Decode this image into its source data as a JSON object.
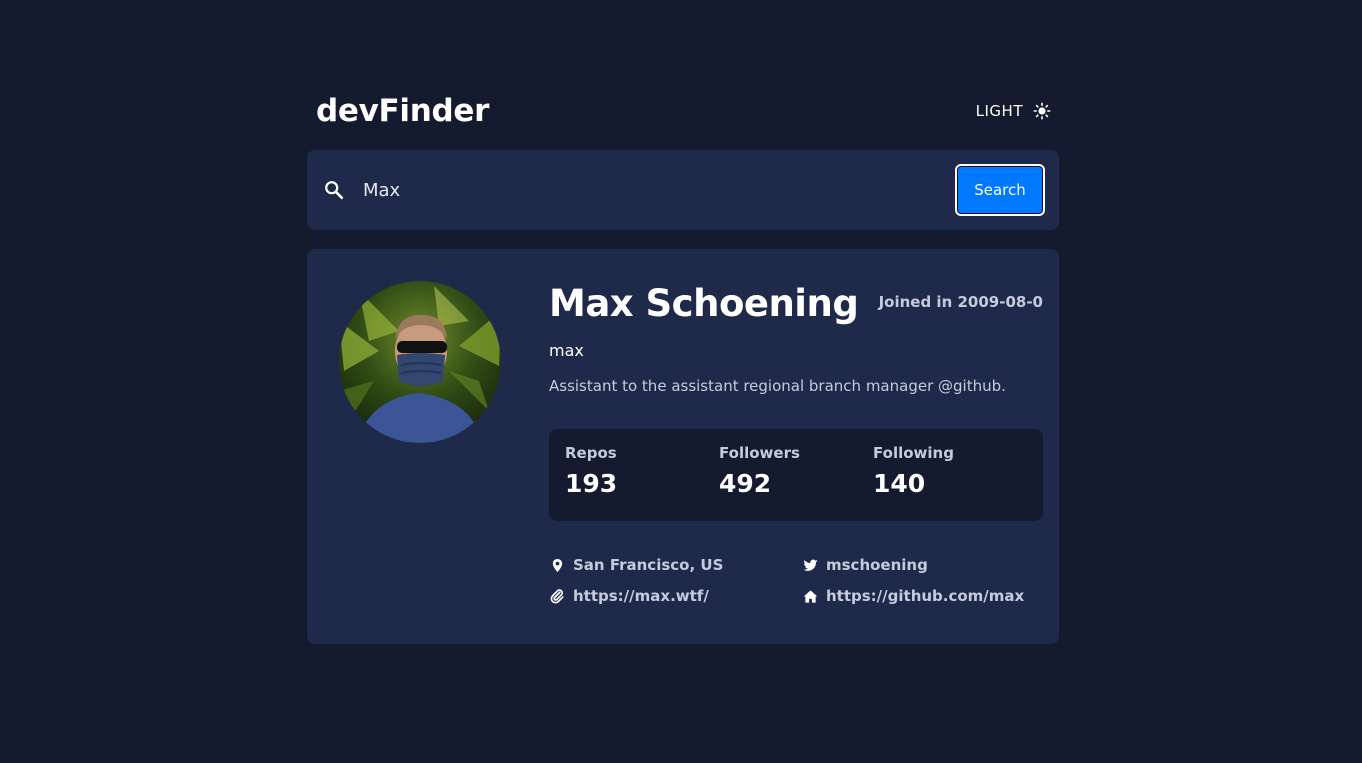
{
  "header": {
    "logo": "devFinder",
    "theme_label": "LIGHT"
  },
  "search": {
    "value": "Max",
    "button_label": "Search"
  },
  "profile": {
    "name": "Max Schoening",
    "joined": "Joined in 2009-08-0",
    "login": "max",
    "bio": "Assistant to the assistant regional branch manager @github.",
    "stats": [
      {
        "label": "Repos",
        "value": "193"
      },
      {
        "label": "Followers",
        "value": "492"
      },
      {
        "label": "Following",
        "value": "140"
      }
    ],
    "links": {
      "location": "San Francisco, US",
      "twitter": "mschoening",
      "website": "https://max.wtf/",
      "company": "https://github.com/max"
    }
  },
  "colors": {
    "background": "#141b2e",
    "card": "#1f2a4a",
    "accent": "#0079ff",
    "muted_text": "#c5cbd9"
  },
  "icons": [
    "sun-icon",
    "search-icon",
    "location-pin-icon",
    "twitter-icon",
    "paperclip-icon",
    "home-icon"
  ]
}
